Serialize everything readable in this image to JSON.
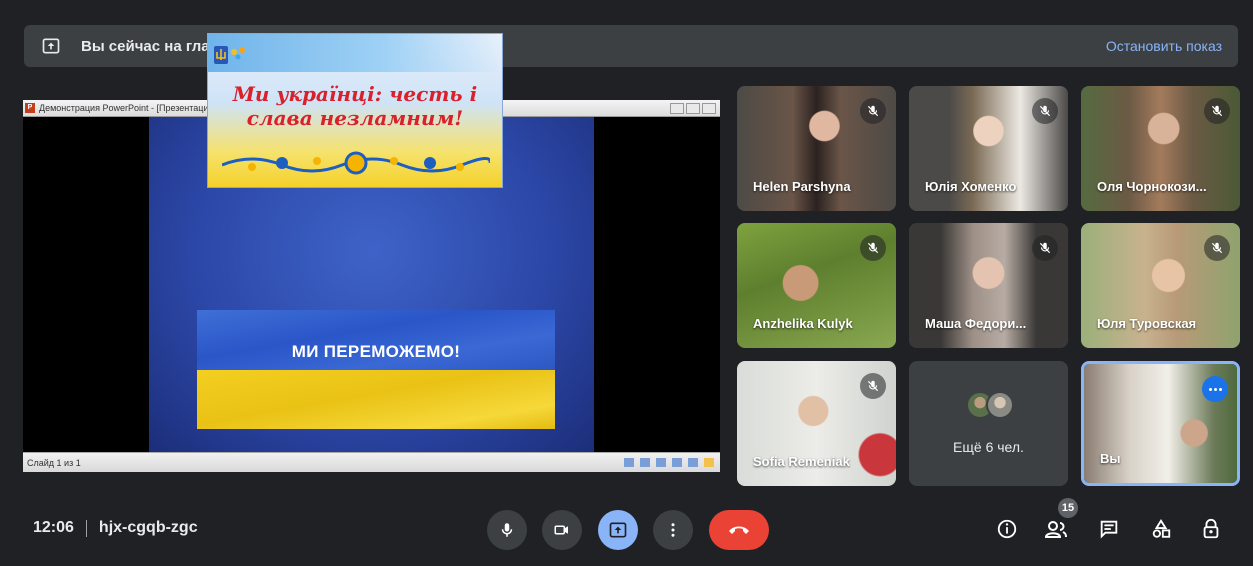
{
  "banner": {
    "text": "Вы сейчас на главном экране",
    "stop_label": "Остановить показ"
  },
  "presentation": {
    "window_title": "Демонстрация PowerPoint - [Презентация Microsoft PowerPoint] - Microsoft PowerPoint",
    "slide_title": "Ми українці: честь і слава незламним!",
    "flag_caption": "МИ ПЕРЕМОЖЕМО!",
    "status_slide": "Слайд 1 из 1"
  },
  "participants": [
    {
      "name": "Helen Parshyna",
      "muted": true
    },
    {
      "name": "Юлія Хоменко",
      "muted": true
    },
    {
      "name": "Оля Чорнокози...",
      "muted": true
    },
    {
      "name": "Anzhelika Kulyk",
      "muted": true
    },
    {
      "name": "Маша Федори...",
      "muted": true
    },
    {
      "name": "Юля Туровская",
      "muted": true
    },
    {
      "name": "Sofia Remeniak",
      "muted": true
    }
  ],
  "others_tile": {
    "label": "Ещё 6 чел."
  },
  "self_tile": {
    "name": "Вы"
  },
  "bottom": {
    "time": "12:06",
    "meeting_code": "hjx-cgqb-zgc",
    "people_count": "15"
  },
  "colors": {
    "background": "#202124",
    "tile": "#3c4043",
    "accent_blue": "#8ab4f8",
    "hangup_red": "#ea4335"
  }
}
